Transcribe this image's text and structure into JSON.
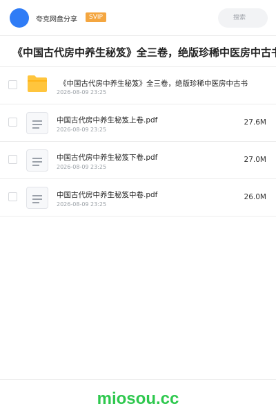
{
  "header": {
    "app_name": "夸克网盘分享",
    "badge": "SVIP",
    "search_placeholder": "搜索"
  },
  "title": "《中国古代房中养生秘笈》全三卷，绝版珍稀中医房中古书",
  "files": [
    {
      "type": "folder",
      "name": "《中国古代房中养生秘笈》全三卷，绝版珍稀中医房中古书",
      "date": "2026-08-09 23:25",
      "size": ""
    },
    {
      "type": "document",
      "name": "中国古代房中养生秘笈上卷.pdf",
      "date": "2026-08-09 23:25",
      "size": "27.6M"
    },
    {
      "type": "document",
      "name": "中国古代房中养生秘笈下卷.pdf",
      "date": "2026-08-09 23:25",
      "size": "27.0M"
    },
    {
      "type": "document",
      "name": "中国古代房中养生秘笈中卷.pdf",
      "date": "2026-08-09 23:25",
      "size": "26.0M"
    }
  ],
  "footer": {
    "watermark": "miosou.cc"
  },
  "colors": {
    "avatar": "#2f7cf6",
    "badge": "#f4a640",
    "folder": "#ffc53d",
    "watermark": "#2ec84e"
  }
}
